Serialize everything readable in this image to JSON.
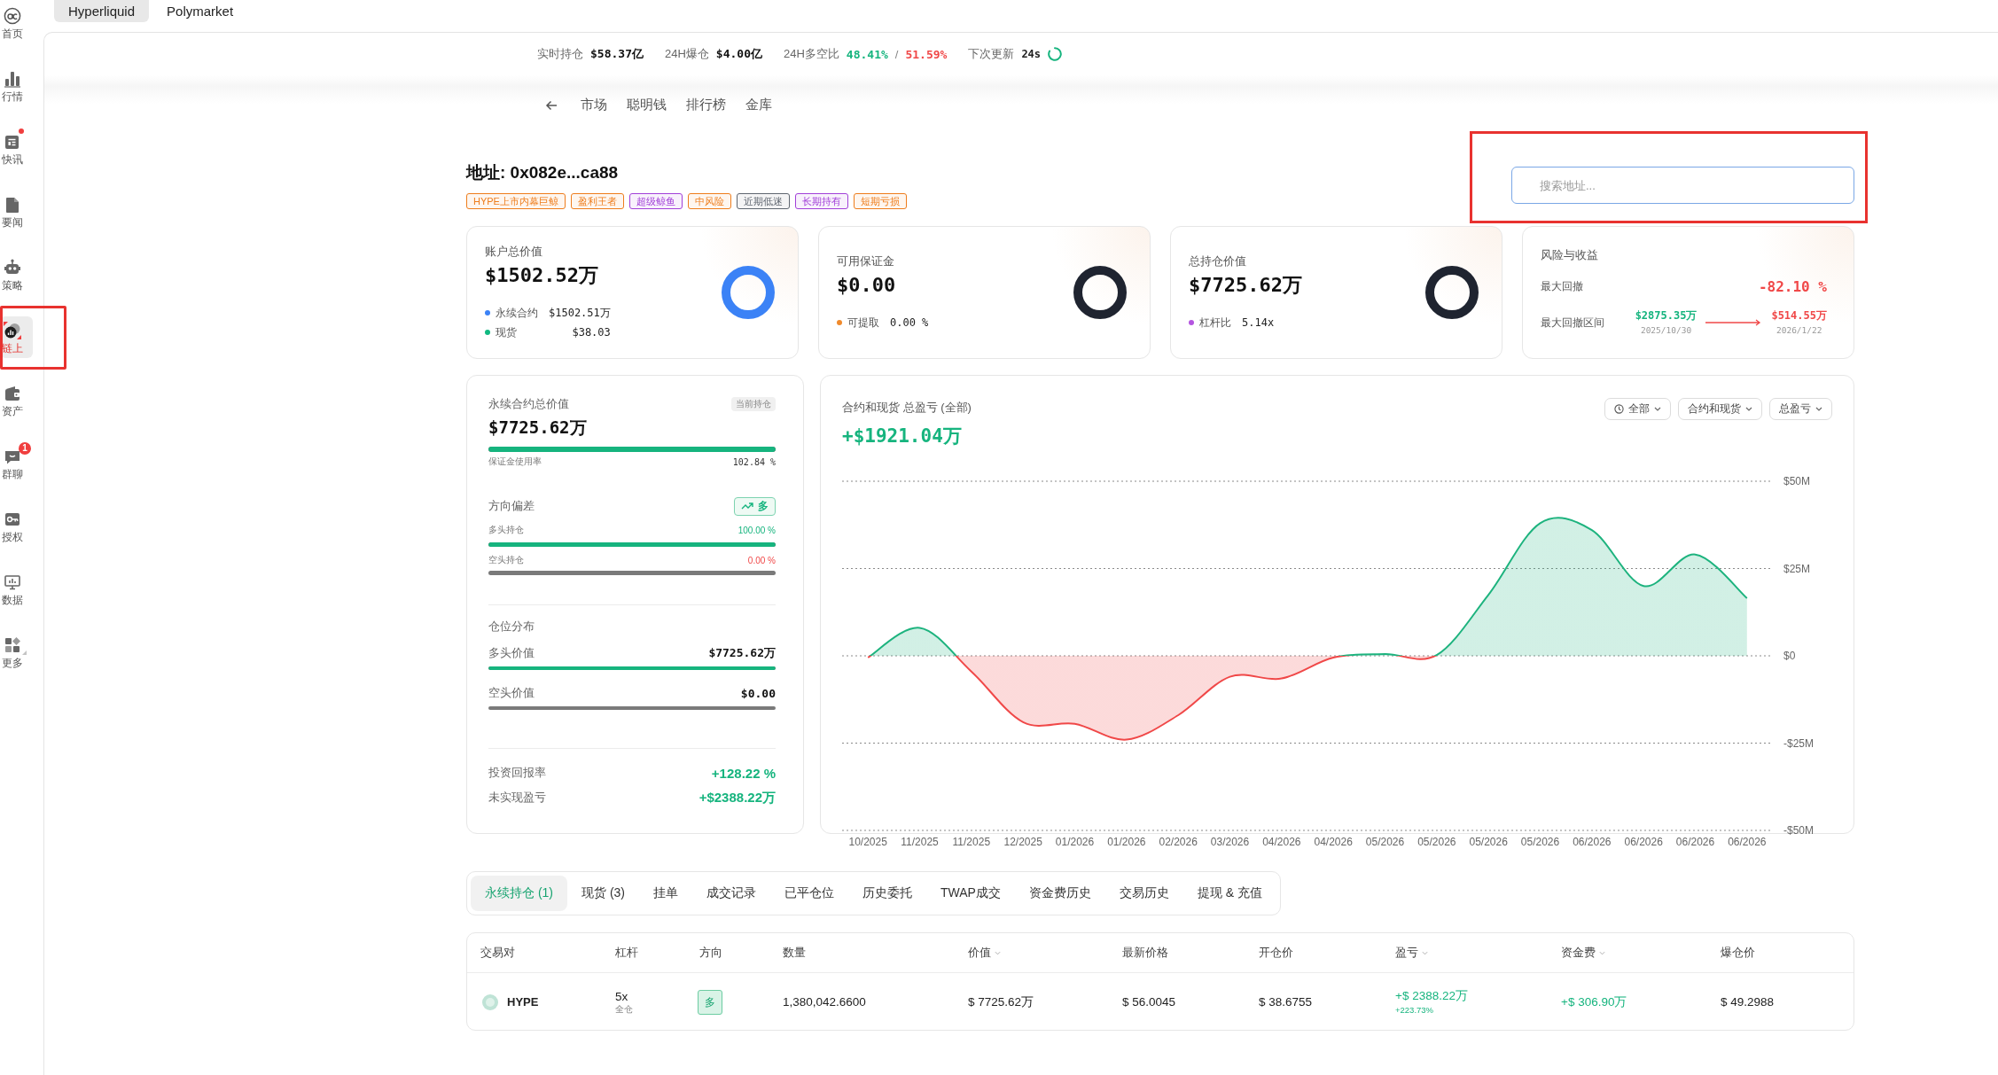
{
  "top_tabs": [
    {
      "label": "Hyperliquid",
      "selected": true
    },
    {
      "label": "Polymarket",
      "selected": false
    }
  ],
  "sidebar": {
    "items": [
      {
        "label": "首页",
        "selected": false,
        "highlighted": false,
        "unread": false
      },
      {
        "label": "行情",
        "selected": false,
        "highlighted": false,
        "unread": false
      },
      {
        "label": "快讯",
        "selected": false,
        "highlighted": false,
        "unread": true
      },
      {
        "label": "要闻",
        "selected": false,
        "highlighted": false,
        "unread": false
      },
      {
        "label": "策略",
        "selected": false,
        "highlighted": false,
        "unread": false
      },
      {
        "label": "链上",
        "selected": true,
        "highlighted": true,
        "unread": false
      },
      {
        "label": "资产",
        "selected": false,
        "highlighted": false,
        "unread": false
      },
      {
        "label": "群聊",
        "selected": false,
        "highlighted": false,
        "unread": false,
        "badge": "1"
      },
      {
        "label": "授权",
        "selected": false,
        "highlighted": false,
        "unread": false
      },
      {
        "label": "数据",
        "selected": false,
        "highlighted": false,
        "unread": false
      },
      {
        "label": "更多",
        "selected": false,
        "highlighted": false,
        "unread": false
      }
    ]
  },
  "stats": [
    {
      "kind": "value",
      "label": "实时持仓",
      "value": "$58.37亿"
    },
    {
      "kind": "value",
      "label": "24H爆仓",
      "value": "$4.00亿"
    },
    {
      "kind": "ratio",
      "label": "24H多空比",
      "long": "48.41%",
      "separator": "/",
      "short": "51.59%"
    },
    {
      "kind": "timer",
      "label": "下次更新",
      "value": "24s"
    }
  ],
  "nav": {
    "items": [
      {
        "label": "市场"
      },
      {
        "label": "聪明钱"
      },
      {
        "label": "排行榜"
      },
      {
        "label": "金库"
      }
    ]
  },
  "address": {
    "title": "地址: 0x082e...ca88",
    "tags": [
      {
        "label": "HYPE上市内幕巨鲸",
        "color": "#ee7d1c"
      },
      {
        "label": "盈利王者",
        "color": "#ee7d1c"
      },
      {
        "label": "超级鲸鱼",
        "color": "#a23fd8"
      },
      {
        "label": "中风险",
        "color": "#ee7d1c"
      },
      {
        "label": "近期低迷",
        "color": "#5f6670"
      },
      {
        "label": "长期持有",
        "color": "#a23fd8"
      },
      {
        "label": "短期亏损",
        "color": "#ee7d1c"
      }
    ]
  },
  "search": {
    "placeholder": "搜索地址...",
    "highlighted": true
  },
  "summary_cards": [
    {
      "label": "账户总价值",
      "value": "$1502.52万",
      "color": "#3b82f6",
      "legend": [
        {
          "label": "永续合约",
          "value": "$1502.51万",
          "color": "#3b82f6"
        },
        {
          "label": "现货",
          "value": "$38.03",
          "color": "#10b981"
        }
      ]
    },
    {
      "label": "可用保证金",
      "value": "$0.00",
      "color": "#1f2430",
      "legend": [
        {
          "label": "可提取",
          "value": "0.00 %",
          "color": "#f08a2c"
        }
      ]
    },
    {
      "label": "总持仓价值",
      "value": "$7725.62万",
      "color": "#1f2430",
      "legend": [
        {
          "label": "杠杆比",
          "value": "5.14x",
          "color": "#b455e0"
        }
      ]
    }
  ],
  "risk": {
    "label": "风险与收益",
    "max_drawdown_label": "最大回撤",
    "max_drawdown": "-82.10 %",
    "range_label": "最大回撤区间",
    "from": {
      "value": "$2875.35万",
      "date": "2025/10/30"
    },
    "to": {
      "value": "$514.55万",
      "date": "2026/1/22"
    }
  },
  "perp": {
    "label": "永续合约总价值",
    "badge": "当前持仓",
    "value": "$7725.62万",
    "margin": {
      "label": "保证金使用率",
      "value": "102.84 %",
      "level": 1
    },
    "bias": {
      "label": "方向偏差",
      "badge": "多",
      "long": {
        "label": "多头持仓",
        "value": "100.00 %",
        "level": 1
      },
      "short": {
        "label": "空头持仓",
        "value": "0.00 %",
        "level": 0
      }
    },
    "distribution": {
      "label": "仓位分布",
      "long": {
        "label": "多头价值",
        "value": "$7725.62万",
        "level": 1
      },
      "short": {
        "label": "空头价值",
        "value": "$0.00",
        "level": 0
      }
    },
    "returns": [
      {
        "label": "投资回报率",
        "value": "+128.22 %"
      },
      {
        "label": "未实现盈亏",
        "value": "+$2388.22万"
      }
    ]
  },
  "pnl": {
    "title": "合约和现货 总盈亏 (全部)",
    "value": "+$1921.04万",
    "filters": [
      {
        "label": "全部",
        "kind": "time"
      },
      {
        "label": "合约和现货",
        "kind": "plain"
      },
      {
        "label": "总盈亏",
        "kind": "plain"
      }
    ],
    "chart_data": {
      "type": "area",
      "categories": [
        "10/2025",
        "11/2025",
        "11/2025",
        "12/2025",
        "01/2026",
        "01/2026",
        "02/2026",
        "03/2026",
        "04/2026",
        "04/2026",
        "05/2026",
        "05/2026",
        "05/2026",
        "05/2026",
        "06/2026",
        "06/2026",
        "06/2026",
        "06/2026"
      ],
      "ylim": [
        -50,
        50
      ],
      "yticks": [
        {
          "value": 50,
          "label": "$50M"
        },
        {
          "value": 25,
          "label": "$25M"
        },
        {
          "value": 0,
          "label": "$0"
        },
        {
          "value": -25,
          "label": "-$25M"
        },
        {
          "value": -50,
          "label": "-$50M"
        }
      ],
      "grid": true,
      "series": [
        {
          "color": "#1db37e",
          "values": [
            -0.5,
            8,
            -4.5,
            -19,
            -19.5,
            -24,
            -17,
            -6,
            -6.5,
            -0.5,
            0.5,
            0.2,
            17.5,
            38,
            36,
            20,
            29,
            16.5
          ]
        }
      ]
    }
  },
  "position_tabs": [
    {
      "label": "永续持仓 (1)",
      "selected": true
    },
    {
      "label": "现货 (3)",
      "selected": false
    },
    {
      "label": "挂单",
      "selected": false
    },
    {
      "label": "成交记录",
      "selected": false
    },
    {
      "label": "已平仓位",
      "selected": false
    },
    {
      "label": "历史委托",
      "selected": false
    },
    {
      "label": "TWAP成交",
      "selected": false
    },
    {
      "label": "资金费历史",
      "selected": false
    },
    {
      "label": "交易历史",
      "selected": false
    },
    {
      "label": "提现 & 充值",
      "selected": false
    }
  ],
  "table": {
    "columns": [
      {
        "label": "交易对",
        "sortable": false
      },
      {
        "label": "杠杆",
        "sortable": false
      },
      {
        "label": "方向",
        "sortable": false
      },
      {
        "label": "数量",
        "sortable": false
      },
      {
        "label": "价值",
        "sortable": true
      },
      {
        "label": "最新价格",
        "sortable": false
      },
      {
        "label": "开仓价",
        "sortable": false
      },
      {
        "label": "盈亏",
        "sortable": true
      },
      {
        "label": "资金费",
        "sortable": true
      },
      {
        "label": "爆仓价",
        "sortable": false
      }
    ],
    "rows": [
      {
        "pair": "HYPE",
        "leverage": "5x",
        "margin_mode": "全仓",
        "side": "多",
        "size": "1,380,042.6600",
        "value": "$ 7725.62万",
        "mark_price": "$ 56.0045",
        "entry_price": "$ 38.6755",
        "pnl": "+$ 2388.22万",
        "pnl_pct": "+223.73%",
        "funding": "+$ 306.90万",
        "liq_price": "$ 49.2988"
      }
    ]
  }
}
